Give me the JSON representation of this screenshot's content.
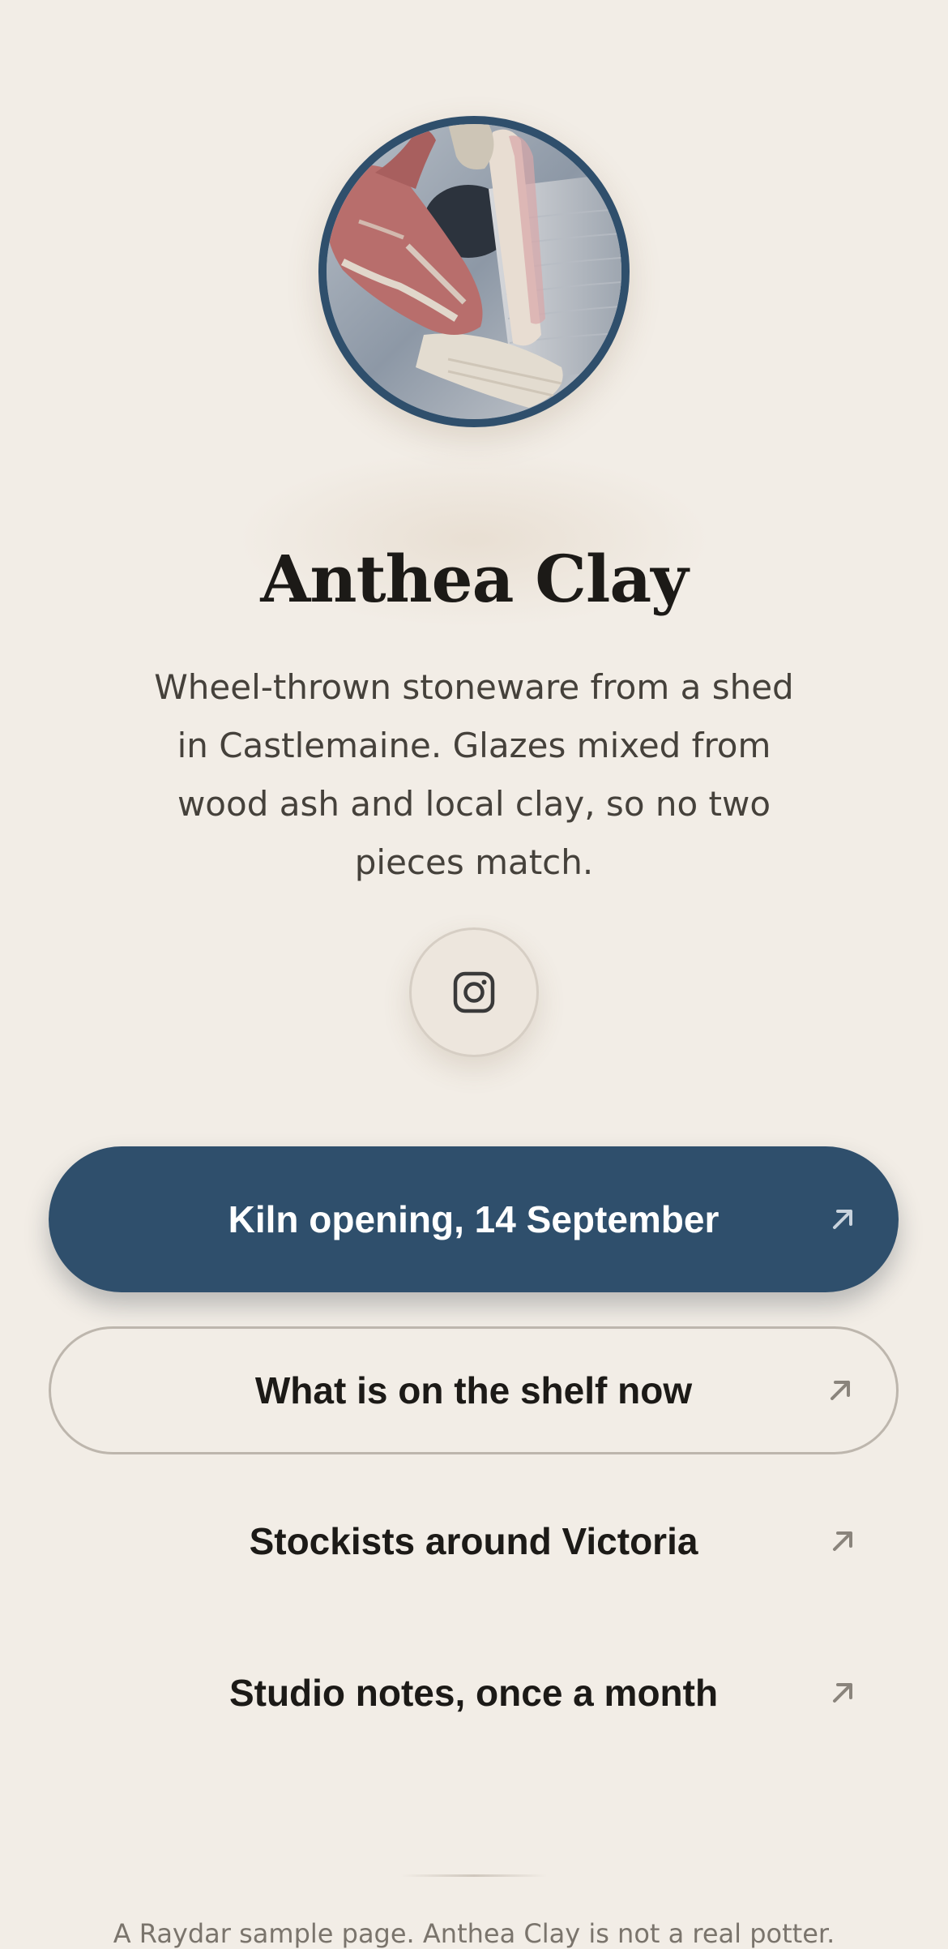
{
  "profile": {
    "name": "Anthea Clay",
    "bio": "Wheel-thrown stoneware from a shed in Castlemaine. Glazes mixed from wood ash and local clay, so no two pieces match.",
    "avatar_alt": "Hands shaping clay on a wheel"
  },
  "social": [
    {
      "icon": "instagram-icon",
      "label": "Instagram"
    }
  ],
  "links": [
    {
      "label": "Kiln opening, 14 September",
      "style": "primary",
      "icon": "arrow-up-right-icon"
    },
    {
      "label": "What is on the shelf now",
      "style": "outline",
      "icon": "arrow-up-right-icon"
    },
    {
      "label": "Stockists around Victoria",
      "style": "plain",
      "icon": "arrow-up-right-icon"
    },
    {
      "label": "Studio notes, once a month",
      "style": "plain",
      "icon": "arrow-up-right-icon"
    }
  ],
  "footer": {
    "text": "A Raydar sample page. Anthea Clay is not a real potter."
  },
  "colors": {
    "background": "#f2ede6",
    "accent": "#2f4f6c",
    "text": "#1c1a17",
    "muted": "#45413b"
  }
}
